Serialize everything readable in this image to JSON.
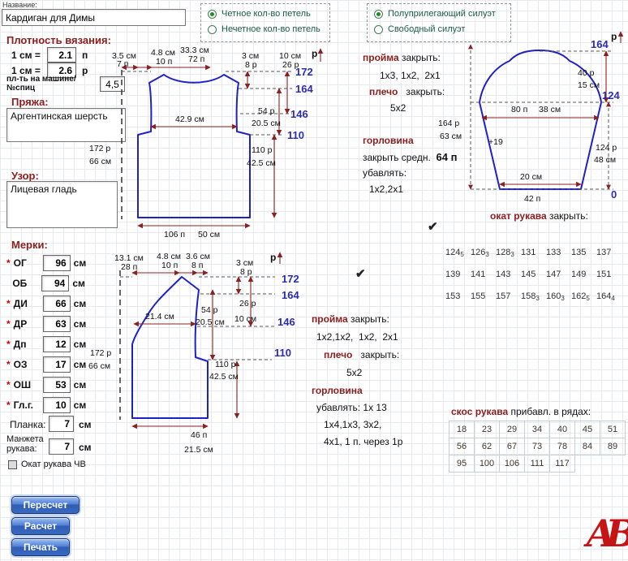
{
  "app": {
    "name_label": "Название:",
    "name_value": "Кардиган для Димы"
  },
  "radios1": {
    "opt1": "Четное кол-во петель",
    "opt2": "Нечетное кол-во петель"
  },
  "radios2": {
    "opt1": "Полуприлегающий силуэт",
    "opt2": "Свободный силуэт"
  },
  "density": {
    "title": "Плотность вязания:",
    "label1": "1 см =",
    "value1": "2.1",
    "unit1": "п",
    "label2": "1 см =",
    "value2": "2.6",
    "unit2": "р",
    "machine1": "пл-ть на машине/",
    "machine2": "№спиц",
    "machine_value": "4,5"
  },
  "yarn": {
    "title": "Пряжа:",
    "value": "Аргентинская шерсть"
  },
  "pattern": {
    "title": "Узор:",
    "value": "Лицевая гладь"
  },
  "merki": {
    "title": "Мерки:",
    "star": "*",
    "unit": "см",
    "rows": [
      {
        "label": "ОГ",
        "value": "96"
      },
      {
        "label": "ОБ",
        "value": "94"
      },
      {
        "label": "ДИ",
        "value": "66"
      },
      {
        "label": "ДР",
        "value": "63"
      },
      {
        "label": "Дп",
        "value": "12"
      },
      {
        "label": "ОЗ",
        "value": "17"
      },
      {
        "label": "ОШ",
        "value": "53"
      },
      {
        "label": "Гл.г.",
        "value": "10"
      }
    ],
    "planka_label": "Планка:",
    "planka_value": "7",
    "cuff_label1": "Манжета",
    "cuff_label2": "рукава:",
    "cuff_value": "7",
    "checkbox_label": "Окат рукава ЧВ"
  },
  "buttons": {
    "recalc": "Пересчет",
    "calc": "Расчет",
    "print": "Печать"
  },
  "back": {
    "d1a": "3.5 см",
    "d1b": "7 п",
    "d2a": "4.8 см",
    "d2b": "10 п",
    "d3a": "33.3 см",
    "d3b": "72 п",
    "d4a": "3 см",
    "d4b": "8 р",
    "d5a": "10 см",
    "d5b": "26 р",
    "axis": "р",
    "r172": "172",
    "r164": "164",
    "r146": "146",
    "r110": "110",
    "left_r": "172 р",
    "left_cm": "66 см",
    "w_inner": "42.9 см",
    "mid_r": "54 р",
    "mid_cm": "20.5 см",
    "low_r": "110 р",
    "low_cm": "42.5 см",
    "bot_p": "106 п",
    "bot_cm": "50 см"
  },
  "back_notes": {
    "t1": "пройма",
    "t1b": "закрыть:",
    "s1": "1х3, 1х2,  2х1",
    "t2": "плечо",
    "t2b": "закрыть:",
    "s2": "5х2",
    "t3": "горловина",
    "l3": "закрыть средн.",
    "l3v": "64 п",
    "l4": "убавлять:",
    "s3": "1х2,2х1",
    "check": "✔"
  },
  "sleeve": {
    "axis": "р",
    "r164": "164",
    "r124": "124",
    "r0": "0",
    "cap_r": "40 р",
    "cap_cm": "15 см",
    "w_p": "80 п",
    "w_cm": "38 см",
    "plus": "+19",
    "left_r": "164 р",
    "left_cm": "63 см",
    "right_r": "124 р",
    "right_cm": "48 см",
    "cuff_cm": "20 см",
    "cuff_p": "42 п",
    "title": "окат рукава",
    "title2": "закрыть:",
    "bindoff": [
      [
        {
          "n": "124",
          "s": "5"
        },
        {
          "n": "126",
          "s": "3"
        },
        {
          "n": "128",
          "s": "3"
        },
        {
          "n": "131",
          "s": ""
        },
        {
          "n": "133",
          "s": ""
        },
        {
          "n": "135",
          "s": ""
        },
        {
          "n": "137",
          "s": ""
        }
      ],
      [
        {
          "n": "139",
          "s": ""
        },
        {
          "n": "141",
          "s": ""
        },
        {
          "n": "143",
          "s": ""
        },
        {
          "n": "145",
          "s": ""
        },
        {
          "n": "147",
          "s": ""
        },
        {
          "n": "149",
          "s": ""
        },
        {
          "n": "151",
          "s": ""
        }
      ],
      [
        {
          "n": "153",
          "s": ""
        },
        {
          "n": "155",
          "s": ""
        },
        {
          "n": "157",
          "s": ""
        },
        {
          "n": "158",
          "s": "3"
        },
        {
          "n": "160",
          "s": "3"
        },
        {
          "n": "162",
          "s": "5"
        },
        {
          "n": "164",
          "s": "4"
        }
      ]
    ]
  },
  "front": {
    "d1a": "13.1 см",
    "d1b": "28 п",
    "d2a": "4.8 см",
    "d2b": "10 п",
    "d3a": "3.6 см",
    "d3b": "8 п",
    "d4a": "3 см",
    "d4b": "8 р",
    "axis": "р",
    "r172": "172",
    "r164": "164",
    "r146": "146",
    "r110": "110",
    "left_r": "172 р",
    "left_cm": "66 см",
    "w_inner": "21.4 см",
    "mid_r": "54 р",
    "mid_cm": "20.5 см",
    "right_r": "26 р",
    "right_cm": "10 см",
    "low_r": "110 р",
    "low_cm": "42.5 см",
    "bot_p": "46 п",
    "bot_cm": "21.5 см"
  },
  "front_notes": {
    "check": "✔",
    "t1": "пройма",
    "t1b": "закрыть:",
    "s1": "1х2,1х2,  1х2,  2х1",
    "t2": "плечо",
    "t2b": "закрыть:",
    "s2": "5х2",
    "t3": "горловина",
    "l4": "убавлять: 1х 13",
    "s3": "1х4,1х3, 3х2,",
    "s4": "4х1, 1 п. через 1р"
  },
  "slope": {
    "title": "скос рукава",
    "subtitle": "прибавл. в рядах:",
    "rows": [
      [
        "18",
        "23",
        "29",
        "34",
        "40",
        "45",
        "51"
      ],
      [
        "56",
        "62",
        "67",
        "73",
        "78",
        "84",
        "89"
      ],
      [
        "95",
        "100",
        "106",
        "111",
        "117",
        "",
        ""
      ]
    ]
  },
  "logo": "АВ"
}
